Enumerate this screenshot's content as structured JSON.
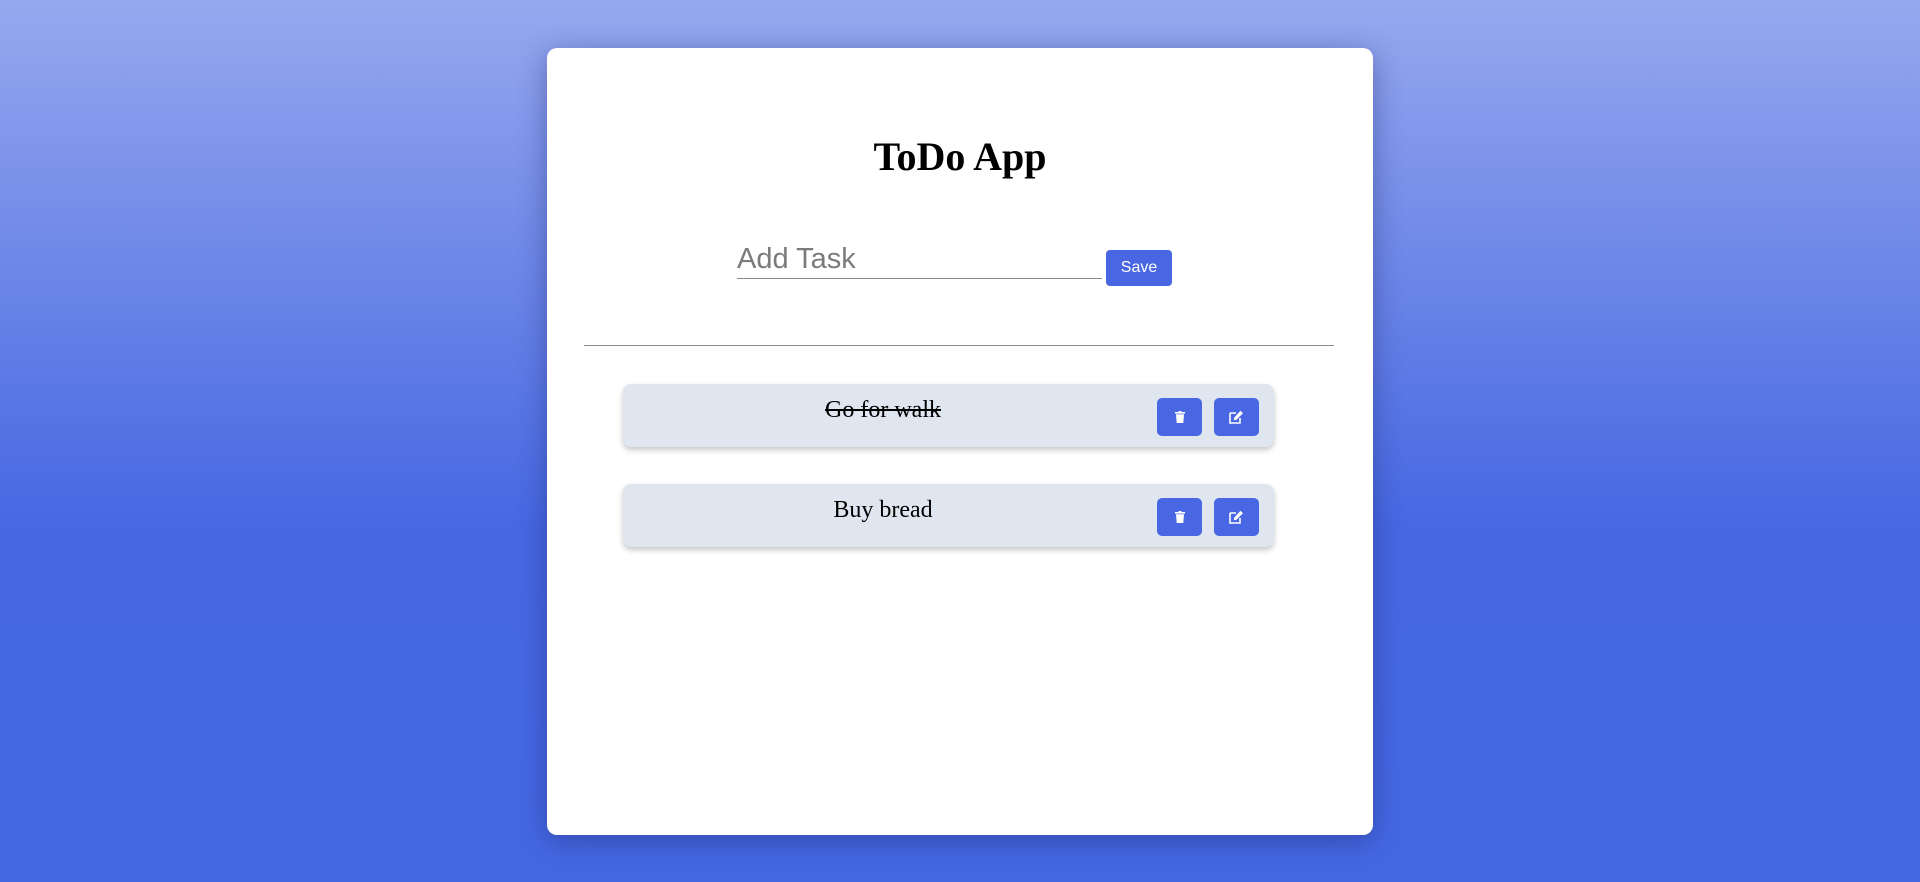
{
  "app": {
    "title": "ToDo App"
  },
  "add_task": {
    "placeholder": "Add Task",
    "value": "",
    "save_label": "Save"
  },
  "tasks": [
    {
      "text": "Go for walk",
      "completed": true,
      "delete_icon": "trash-icon",
      "edit_icon": "edit-icon"
    },
    {
      "text": "Buy bread",
      "completed": false,
      "delete_icon": "trash-icon",
      "edit_icon": "edit-icon"
    }
  ],
  "colors": {
    "accent": "#4a67e3",
    "task_background": "#e0e6f0",
    "card_background": "#ffffff"
  }
}
